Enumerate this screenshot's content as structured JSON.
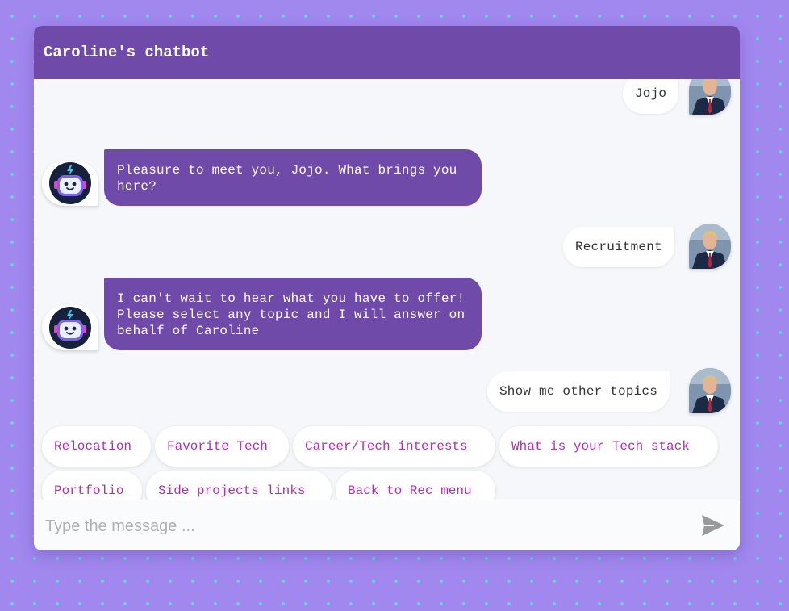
{
  "header": {
    "title": "Caroline's chatbot"
  },
  "messages": [
    {
      "from": "user",
      "text": "Jojo"
    },
    {
      "from": "bot",
      "text": "Pleasure to meet you, Jojo. What brings you here?"
    },
    {
      "from": "user",
      "text": "Recruitment"
    },
    {
      "from": "bot",
      "text": "I can't wait to hear what you have to offer! Please select any topic and I will answer on behalf of Caroline"
    },
    {
      "from": "user",
      "text": "Show me other topics"
    }
  ],
  "options": [
    "Relocation",
    "Favorite Tech",
    "Career/Tech interests",
    "What is your Tech stack",
    "Portfolio",
    "Side projects links",
    "Back to Rec menu"
  ],
  "composer": {
    "placeholder": "Type the message ...",
    "value": ""
  },
  "icons": {
    "bot_avatar": "robot-avatar-icon",
    "user_avatar": "user-photo-avatar",
    "send": "send-icon"
  },
  "colors": {
    "background": "#a088ef",
    "dots": "#57e0d3",
    "header": "#6f4aa8",
    "bot_bubble": "#6f4aa8",
    "option_text": "#b02fb0"
  }
}
